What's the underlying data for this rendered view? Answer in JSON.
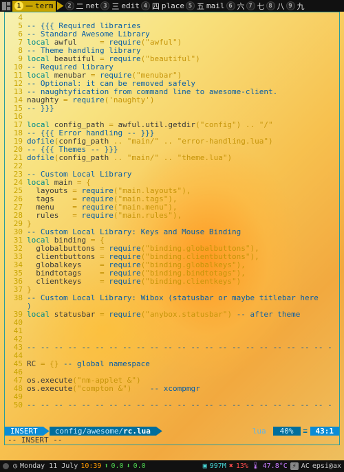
{
  "workspaces": [
    {
      "num": "1",
      "sym": "一",
      "label": "term",
      "active": true
    },
    {
      "num": "2",
      "sym": "二",
      "label": "net",
      "active": false
    },
    {
      "num": "3",
      "sym": "三",
      "label": "edit",
      "active": false
    },
    {
      "num": "4",
      "sym": "四",
      "label": "place",
      "active": false
    },
    {
      "num": "5",
      "sym": "五",
      "label": "mail",
      "active": false
    },
    {
      "num": "6",
      "sym": "六",
      "label": "",
      "active": false
    },
    {
      "num": "7",
      "sym": "七",
      "label": "",
      "active": false
    },
    {
      "num": "8",
      "sym": "八",
      "label": "",
      "active": false
    },
    {
      "num": "9",
      "sym": "九",
      "label": "",
      "active": false
    }
  ],
  "code": [
    {
      "n": 4,
      "t": []
    },
    {
      "n": 5,
      "t": [
        [
          "cm",
          "-- {{{ Required libraries"
        ]
      ]
    },
    {
      "n": 6,
      "t": [
        [
          "cm",
          "-- Standard Awesome Library"
        ]
      ]
    },
    {
      "n": 7,
      "t": [
        [
          "kw",
          "local"
        ],
        [
          "id",
          " awful     "
        ],
        [
          "op",
          "= "
        ],
        [
          "fn",
          "require"
        ],
        [
          "op",
          "("
        ],
        [
          "str",
          "\"awful\""
        ],
        [
          "op",
          ")"
        ]
      ]
    },
    {
      "n": 8,
      "t": [
        [
          "cm",
          "-- Theme handling library"
        ]
      ]
    },
    {
      "n": 9,
      "t": [
        [
          "kw",
          "local"
        ],
        [
          "id",
          " beautiful "
        ],
        [
          "op",
          "= "
        ],
        [
          "fn",
          "require"
        ],
        [
          "op",
          "("
        ],
        [
          "str",
          "\"beautiful\""
        ],
        [
          "op",
          ")"
        ]
      ]
    },
    {
      "n": 10,
      "t": [
        [
          "cm",
          "-- Required library"
        ]
      ]
    },
    {
      "n": 11,
      "t": [
        [
          "kw",
          "local"
        ],
        [
          "id",
          " menubar "
        ],
        [
          "op",
          "= "
        ],
        [
          "fn",
          "require"
        ],
        [
          "op",
          "("
        ],
        [
          "str",
          "\"menubar\""
        ],
        [
          "op",
          ")"
        ]
      ]
    },
    {
      "n": 12,
      "t": [
        [
          "cm",
          "-- Optional: it can be removed safely"
        ]
      ]
    },
    {
      "n": 13,
      "t": [
        [
          "cm",
          "-- naughtyfication from command line to awesome-client."
        ]
      ]
    },
    {
      "n": 14,
      "t": [
        [
          "id",
          "naughty "
        ],
        [
          "op",
          "= "
        ],
        [
          "fn",
          "require"
        ],
        [
          "op",
          "("
        ],
        [
          "str",
          "'naughty'"
        ],
        [
          "op",
          ")"
        ]
      ]
    },
    {
      "n": 15,
      "t": [
        [
          "cm",
          "-- }}}"
        ]
      ]
    },
    {
      "n": 16,
      "t": []
    },
    {
      "n": 17,
      "t": [
        [
          "kw",
          "local"
        ],
        [
          "id",
          " config_path "
        ],
        [
          "op",
          "= "
        ],
        [
          "id",
          "awful.util.getdir"
        ],
        [
          "op",
          "("
        ],
        [
          "str",
          "\"config\""
        ],
        [
          "op",
          ") "
        ],
        [
          "op",
          ".. "
        ],
        [
          "str",
          "\"/\""
        ]
      ]
    },
    {
      "n": 18,
      "t": [
        [
          "cm",
          "-- {{{ Error handling -- }}}"
        ]
      ]
    },
    {
      "n": 19,
      "t": [
        [
          "fn",
          "dofile"
        ],
        [
          "op",
          "("
        ],
        [
          "id",
          "config_path "
        ],
        [
          "op",
          ".. "
        ],
        [
          "str",
          "\"main/\""
        ],
        [
          "op",
          " .. "
        ],
        [
          "str",
          "\"error-handling.lua\""
        ],
        [
          "op",
          ")"
        ]
      ]
    },
    {
      "n": 20,
      "t": [
        [
          "cm",
          "-- {{{ Themes -- }}}"
        ]
      ]
    },
    {
      "n": 21,
      "t": [
        [
          "fn",
          "dofile"
        ],
        [
          "op",
          "("
        ],
        [
          "id",
          "config_path "
        ],
        [
          "op",
          ".. "
        ],
        [
          "str",
          "\"main/\""
        ],
        [
          "op",
          " .. "
        ],
        [
          "str",
          "\"theme.lua\""
        ],
        [
          "op",
          ")"
        ]
      ]
    },
    {
      "n": 22,
      "t": []
    },
    {
      "n": 23,
      "t": [
        [
          "cm",
          "-- Custom Local Library"
        ]
      ]
    },
    {
      "n": 24,
      "t": [
        [
          "kw",
          "local"
        ],
        [
          "id",
          " main "
        ],
        [
          "op",
          "= {"
        ]
      ]
    },
    {
      "n": 25,
      "t": [
        [
          "id",
          "  layouts "
        ],
        [
          "op",
          "= "
        ],
        [
          "fn",
          "require"
        ],
        [
          "op",
          "("
        ],
        [
          "str",
          "\"main.layouts\""
        ],
        [
          "op",
          "),"
        ]
      ]
    },
    {
      "n": 26,
      "t": [
        [
          "id",
          "  tags    "
        ],
        [
          "op",
          "= "
        ],
        [
          "fn",
          "require"
        ],
        [
          "op",
          "("
        ],
        [
          "str",
          "\"main.tags\""
        ],
        [
          "op",
          "),"
        ]
      ]
    },
    {
      "n": 27,
      "t": [
        [
          "id",
          "  menu    "
        ],
        [
          "op",
          "= "
        ],
        [
          "fn",
          "require"
        ],
        [
          "op",
          "("
        ],
        [
          "str",
          "\"main.menu\""
        ],
        [
          "op",
          "),"
        ]
      ]
    },
    {
      "n": 28,
      "t": [
        [
          "id",
          "  rules   "
        ],
        [
          "op",
          "= "
        ],
        [
          "fn",
          "require"
        ],
        [
          "op",
          "("
        ],
        [
          "str",
          "\"main.rules\""
        ],
        [
          "op",
          "),"
        ]
      ]
    },
    {
      "n": 29,
      "t": [
        [
          "op",
          "}"
        ]
      ]
    },
    {
      "n": 30,
      "t": [
        [
          "cm",
          "-- Custom Local Library: Keys and Mouse Binding"
        ]
      ]
    },
    {
      "n": 31,
      "t": [
        [
          "kw",
          "local"
        ],
        [
          "id",
          " binding "
        ],
        [
          "op",
          "= {"
        ]
      ]
    },
    {
      "n": 32,
      "t": [
        [
          "id",
          "  globalbuttons "
        ],
        [
          "op",
          "= "
        ],
        [
          "fn",
          "require"
        ],
        [
          "op",
          "("
        ],
        [
          "str",
          "\"binding.globalbuttons\""
        ],
        [
          "op",
          "),"
        ]
      ]
    },
    {
      "n": 33,
      "t": [
        [
          "id",
          "  clientbuttons "
        ],
        [
          "op",
          "= "
        ],
        [
          "fn",
          "require"
        ],
        [
          "op",
          "("
        ],
        [
          "str",
          "\"binding.clientbuttons\""
        ],
        [
          "op",
          "),"
        ]
      ]
    },
    {
      "n": 34,
      "t": [
        [
          "id",
          "  globalkeys    "
        ],
        [
          "op",
          "= "
        ],
        [
          "fn",
          "require"
        ],
        [
          "op",
          "("
        ],
        [
          "str",
          "\"binding.globalkeys\""
        ],
        [
          "op",
          "),"
        ]
      ]
    },
    {
      "n": 35,
      "t": [
        [
          "id",
          "  bindtotags    "
        ],
        [
          "op",
          "= "
        ],
        [
          "fn",
          "require"
        ],
        [
          "op",
          "("
        ],
        [
          "str",
          "\"binding.bindtotags\""
        ],
        [
          "op",
          "),"
        ]
      ]
    },
    {
      "n": 36,
      "t": [
        [
          "id",
          "  clientkeys    "
        ],
        [
          "op",
          "= "
        ],
        [
          "fn",
          "require"
        ],
        [
          "op",
          "("
        ],
        [
          "str",
          "\"binding.clientkeys\""
        ],
        [
          "op",
          ")"
        ]
      ]
    },
    {
      "n": 37,
      "t": [
        [
          "op",
          "}"
        ]
      ]
    },
    {
      "n": 38,
      "t": [
        [
          "cm",
          "-- Custom Local Library: Wibox (statusbar or maybe titlebar here\n)"
        ]
      ]
    },
    {
      "n": 39,
      "t": [
        [
          "kw",
          "local"
        ],
        [
          "id",
          " statusbar "
        ],
        [
          "op",
          "= "
        ],
        [
          "fn",
          "require"
        ],
        [
          "op",
          "("
        ],
        [
          "str",
          "\"anybox.statusbar\""
        ],
        [
          "op",
          ") "
        ],
        [
          "cm",
          "-- after theme"
        ]
      ]
    },
    {
      "n": 40,
      "t": []
    },
    {
      "n": 41,
      "t": []
    },
    {
      "n": 42,
      "t": []
    },
    {
      "n": 43,
      "t": [
        [
          "cm",
          "-- -- -- -- -- -- -- -- -- -- -- -- -- -- -- -- -- -- -- -- -- -- -"
        ]
      ]
    },
    {
      "n": 44,
      "t": []
    },
    {
      "n": 45,
      "t": [
        [
          "id",
          "RC "
        ],
        [
          "op",
          "= {} "
        ],
        [
          "cm",
          "-- global namespace"
        ]
      ]
    },
    {
      "n": 46,
      "t": []
    },
    {
      "n": 47,
      "t": [
        [
          "id",
          "os.execute"
        ],
        [
          "op",
          "("
        ],
        [
          "str",
          "\"nm-applet &\""
        ],
        [
          "op",
          ")"
        ]
      ]
    },
    {
      "n": 48,
      "t": [
        [
          "id",
          "os.execute"
        ],
        [
          "op",
          "("
        ],
        [
          "str",
          "\"compton &\""
        ],
        [
          "op",
          ")    "
        ],
        [
          "cm",
          "-- xcompmgr"
        ]
      ]
    },
    {
      "n": 49,
      "t": []
    },
    {
      "n": 50,
      "t": [
        [
          "cm",
          "-- -- -- -- -- -- -- -- -- -- -- -- -- -- -- -- -- -- -- -- -- -- -"
        ]
      ]
    }
  ],
  "statusline": {
    "mode": "INSERT",
    "path": "config/awesome/",
    "file": "rc.lua",
    "filetype": "lua",
    "percent": "40%",
    "pos": "43:1"
  },
  "insert_echo": "-- INSERT --",
  "bottom": {
    "day": "Monday 11 July",
    "time": "10:39",
    "up": "0.0",
    "down": "0.0",
    "mem": "997M",
    "cpu": "13%",
    "temp": "47.8°C",
    "power": "AC",
    "user": "epsi@ax"
  }
}
